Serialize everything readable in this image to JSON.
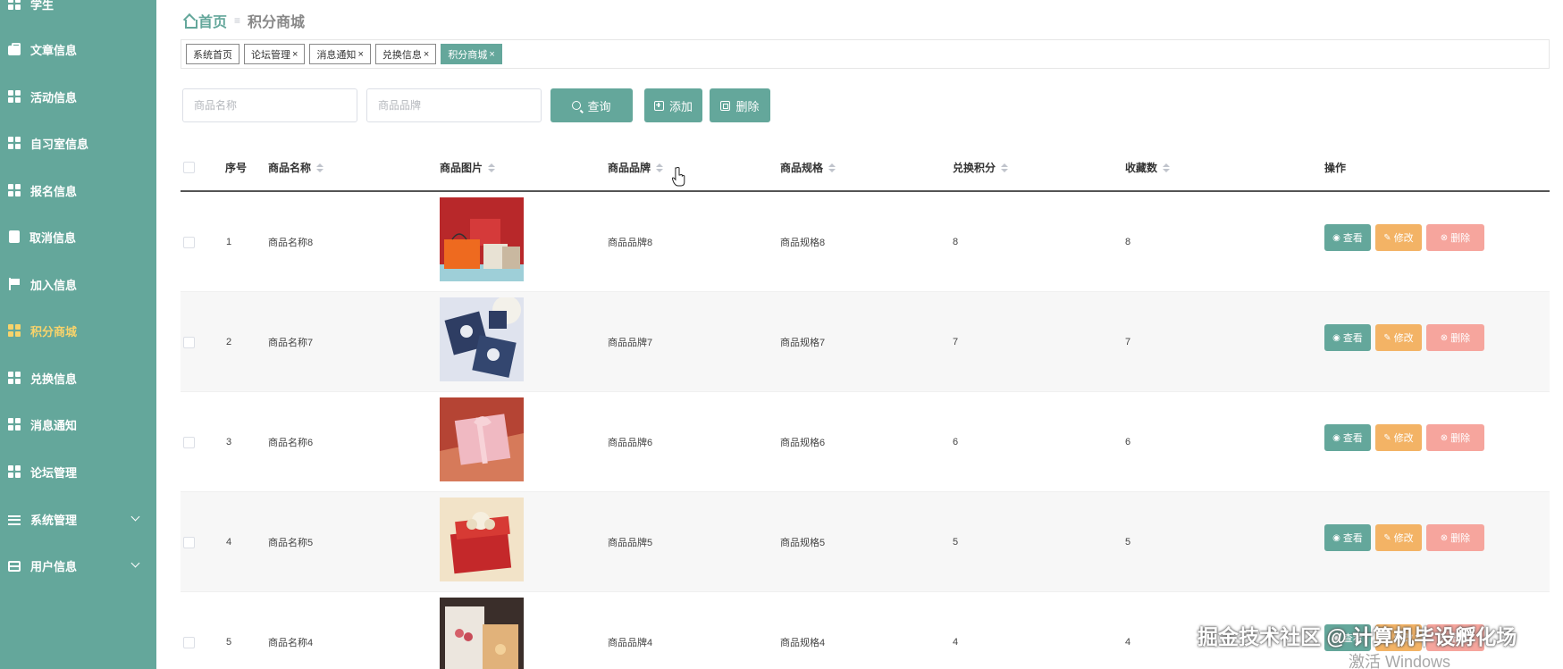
{
  "sidebar": {
    "items": [
      {
        "label": "学生",
        "icon": "grid-icon"
      },
      {
        "label": "文章信息",
        "icon": "briefcase-icon"
      },
      {
        "label": "活动信息",
        "icon": "grid-icon"
      },
      {
        "label": "自习室信息",
        "icon": "grid-icon"
      },
      {
        "label": "报名信息",
        "icon": "grid-icon"
      },
      {
        "label": "取消信息",
        "icon": "clipboard-icon"
      },
      {
        "label": "加入信息",
        "icon": "flag-icon"
      },
      {
        "label": "积分商城",
        "icon": "grid-icon",
        "active": true
      },
      {
        "label": "兑换信息",
        "icon": "grid-icon"
      },
      {
        "label": "消息通知",
        "icon": "grid-icon"
      },
      {
        "label": "论坛管理",
        "icon": "grid-icon"
      },
      {
        "label": "系统管理",
        "icon": "menu-icon",
        "expandable": true
      },
      {
        "label": "用户信息",
        "icon": "card-icon",
        "expandable": true
      }
    ]
  },
  "breadcrumb": {
    "home": "首页",
    "current": "积分商城"
  },
  "tags": [
    {
      "label": "系统首页",
      "closable": false
    },
    {
      "label": "论坛管理",
      "closable": true
    },
    {
      "label": "消息通知",
      "closable": true
    },
    {
      "label": "兑换信息",
      "closable": true
    },
    {
      "label": "积分商城",
      "closable": true,
      "active": true
    }
  ],
  "tag_close": "×",
  "search": {
    "name_placeholder": "商品名称",
    "brand_placeholder": "商品品牌",
    "query_label": "查询",
    "add_label": "添加",
    "delete_label": "删除"
  },
  "table": {
    "columns": [
      "序号",
      "商品名称",
      "商品图片",
      "商品品牌",
      "商品规格",
      "兑换积分",
      "收藏数",
      "操作"
    ],
    "rows": [
      {
        "index": "1",
        "name": "商品名称8",
        "image": "gift-box-orange",
        "brand": "商品品牌8",
        "spec": "商品规格8",
        "points": "8",
        "favorites": "8"
      },
      {
        "index": "2",
        "name": "商品名称7",
        "image": "gift-box-navy",
        "brand": "商品品牌7",
        "spec": "商品规格7",
        "points": "7",
        "favorites": "7"
      },
      {
        "index": "3",
        "name": "商品名称6",
        "image": "gift-box-pink",
        "brand": "商品品牌6",
        "spec": "商品规格6",
        "points": "6",
        "favorites": "6"
      },
      {
        "index": "4",
        "name": "商品名称5",
        "image": "gift-box-red",
        "brand": "商品品牌5",
        "spec": "商品规格5",
        "points": "5",
        "favorites": "5"
      },
      {
        "index": "5",
        "name": "商品名称4",
        "image": "gift-bag-flowers",
        "brand": "商品品牌4",
        "spec": "商品规格4",
        "points": "4",
        "favorites": "4"
      }
    ],
    "actions": {
      "view": "查看",
      "edit": "修改",
      "delete": "删除"
    }
  },
  "watermark": "掘金技术社区 @ 计算机毕设孵化场",
  "os_watermark": "激活 Windows",
  "colors": {
    "primary": "#64a79b",
    "sidebar_bg": "#64a79b",
    "active_menu": "#f7d36b",
    "edit": "#f3b365",
    "delete": "#f6a59d"
  }
}
